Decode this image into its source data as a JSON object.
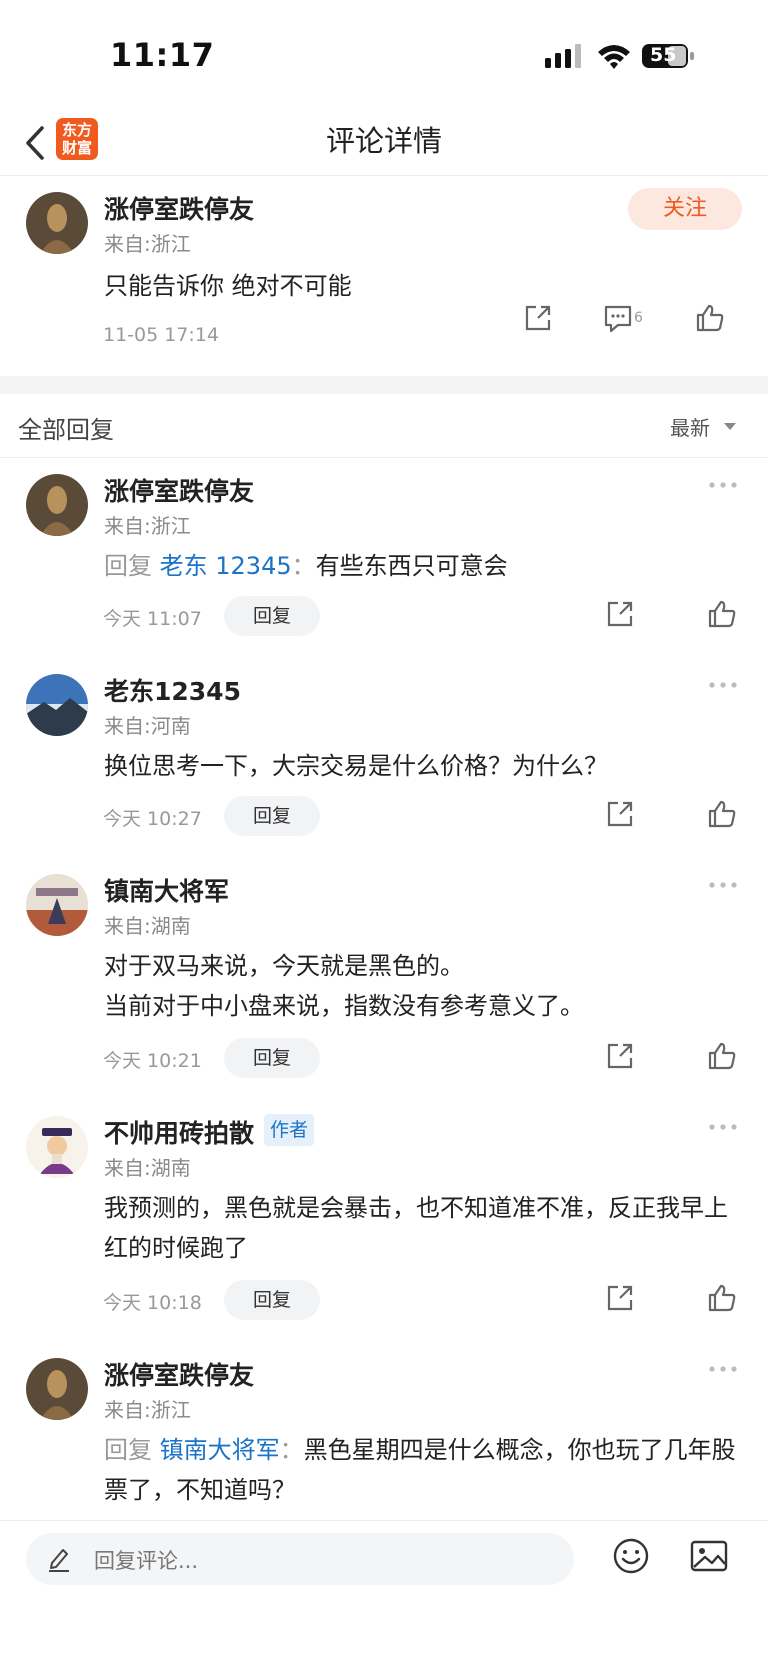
{
  "status_bar": {
    "time": "11:17",
    "battery": "55"
  },
  "nav": {
    "title": "评论详情",
    "logo_line1": "东方",
    "logo_line2": "财富"
  },
  "main_comment": {
    "user": "涨停室跌停友",
    "from": "来自:浙江",
    "text": "只能告诉你 绝对不可能",
    "date": "11-05 17:14",
    "reply_count": "6",
    "follow_label": "关注"
  },
  "section": {
    "title": "全部回复",
    "sort_label": "最新"
  },
  "replies": [
    {
      "user": "涨停室跌停友",
      "from": "来自:浙江",
      "lead": "回复 ",
      "target": "老东 12345",
      "colon": "：",
      "text": "有些东西只可意会",
      "time": "今天 11:07",
      "reply_label": "回复"
    },
    {
      "user": "老东12345",
      "from": "来自:河南",
      "text": "换位思考一下，大宗交易是什么价格？为什么？",
      "time": "今天 10:27",
      "reply_label": "回复"
    },
    {
      "user": "镇南大将军",
      "from": "来自:湖南",
      "text_line1": "对于双马来说，今天就是黑色的。",
      "text_line2": "当前对于中小盘来说，指数没有参考意义了。",
      "time": "今天 10:21",
      "reply_label": "回复"
    },
    {
      "user": "不帅用砖拍散",
      "tag": "作者",
      "from": "来自:湖南",
      "text": "我预测的，黑色就是会暴击，也不知道准不准，反正我早上红的时候跑了",
      "time": "今天 10:18",
      "reply_label": "回复"
    },
    {
      "user": "涨停室跌停友",
      "from": "来自:浙江",
      "lead": "回复 ",
      "target": "镇南大将军",
      "colon": "：",
      "text": "黑色星期四是什么概念，你也玩了几年股票了，不知道吗？"
    }
  ],
  "bottom_bar": {
    "placeholder": "回复评论..."
  },
  "colors": {
    "brand": "#f05a1e",
    "link": "#1a73c9",
    "muted": "#999999"
  }
}
